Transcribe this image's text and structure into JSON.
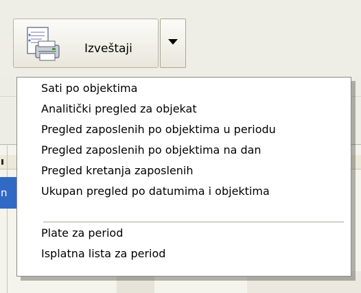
{
  "toolbar": {
    "reports_label": "Izveštaji",
    "report_icon": "printer-report-icon",
    "dropdown_icon": "chevron-down-icon"
  },
  "background": {
    "selected_cell_text": "n"
  },
  "menu": {
    "items": [
      "Sati po objektima",
      "Analitički pregled za objekat",
      "Pregled zaposlenih po objektima u periodu",
      "Pregled zaposlenih po objektima na dan",
      "Pregled kretanja zaposlenih",
      "Ukupan pregled po datumima i objektima",
      "Plate za period",
      "Isplatna lista za period"
    ]
  },
  "colors": {
    "selection": "#316ac5",
    "menu_background": "#ffffff",
    "toolbar_background": "#efeee6"
  }
}
